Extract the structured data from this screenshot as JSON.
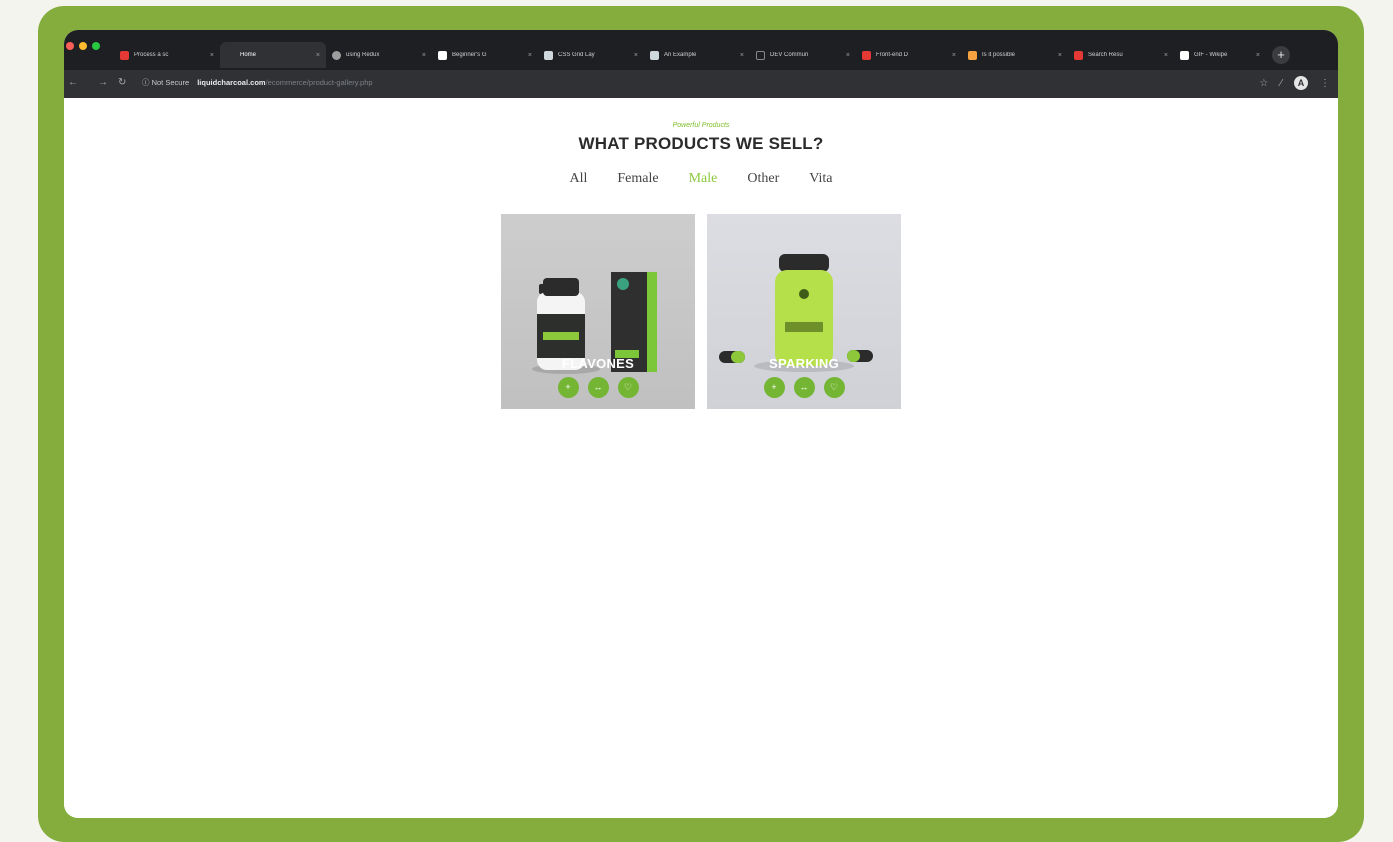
{
  "browser": {
    "tabs": [
      {
        "label": "Process a sc",
        "color": "#e53935",
        "active": false
      },
      {
        "label": "Home",
        "color": "#2f3134",
        "active": true
      },
      {
        "label": "using Redux",
        "color": "#9e9e9e",
        "active": false
      },
      {
        "label": "Beginner's G",
        "color": "#ffffff",
        "active": false
      },
      {
        "label": "CSS Grid Lay",
        "color": "#cfd8dc",
        "active": false
      },
      {
        "label": "An Example",
        "color": "#cfd8dc",
        "active": false
      },
      {
        "label": "DEV Commun",
        "color": "#1e1f22",
        "active": false
      },
      {
        "label": "Front-end D",
        "color": "#e53935",
        "active": false
      },
      {
        "label": "Is it possible",
        "color": "#f4a340",
        "active": false
      },
      {
        "label": "Search Resu",
        "color": "#e53935",
        "active": false
      },
      {
        "label": "GIF - Wikipe",
        "color": "#ffffff",
        "active": false
      }
    ],
    "close_glyph": "×",
    "new_tab_glyph": "+",
    "security_label": "Not Secure",
    "url_host": "liquidcharcoal.com",
    "url_path": "/ecommerce/product-gallery.php",
    "avatar_initial": "A"
  },
  "page": {
    "kicker": "Powerful Products",
    "heading": "WHAT PRODUCTS WE SELL?",
    "filters": [
      "All",
      "Female",
      "Male",
      "Other",
      "Vita"
    ],
    "active_filter": "Male",
    "products": [
      {
        "title": "FLAVONES",
        "actions": [
          "+",
          "↔",
          "♡"
        ]
      },
      {
        "title": "SPARKING",
        "actions": [
          "+",
          "↔",
          "♡"
        ]
      }
    ]
  },
  "colors": {
    "frame": "#84ad3d",
    "accent": "#8cc83a",
    "action_button": "#74b533"
  }
}
